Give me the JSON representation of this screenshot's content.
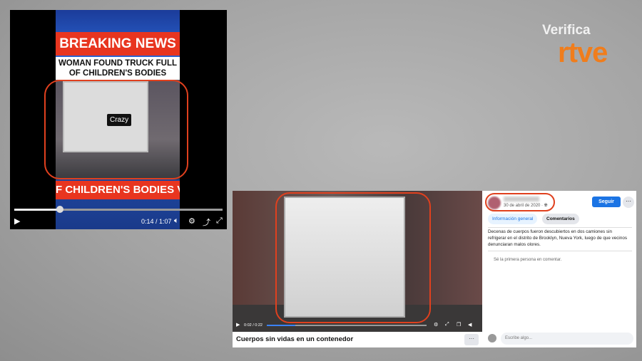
{
  "logo": {
    "line1": "Verifica",
    "line2": "rtve"
  },
  "left_video": {
    "headline_band": "BREAKING NEWS",
    "headline": "WOMAN FOUND TRUCK FULL OF CHILDREN'S BODIES",
    "sticker": "Crazy",
    "ticker": "F CHILDREN'S BODIES V",
    "time": "0:14 / 1:07",
    "progress": 0.22,
    "controls": [
      "play-icon",
      "volume-icon",
      "settings-icon",
      "share-icon",
      "fullscreen-icon"
    ]
  },
  "right_video": {
    "time": "0:02 / 0:22",
    "progress": 0.18,
    "caption": "Cuerpos sin vidas en un contenedor",
    "more": "···"
  },
  "fb_panel": {
    "date": "30 de abril de 2020 · ",
    "follow": "Seguir",
    "more": "···",
    "tabs": [
      "Información general",
      "Comentarios"
    ],
    "description": "Decenas de cuerpos fueron descubiertos en dos camiones sin refrigerar en el distrito de Brooklyn, Nueva York, luego de que vecinos denunciaran malos olores.",
    "first_comment": "Sé la primera persona en comentar.",
    "comment_placeholder": "Escribe algo..."
  },
  "colors": {
    "highlight": "#e0401e",
    "rtve_orange": "#f07d1c",
    "facebook_blue": "#1b74e4",
    "breaking_red": "#e8351f"
  }
}
